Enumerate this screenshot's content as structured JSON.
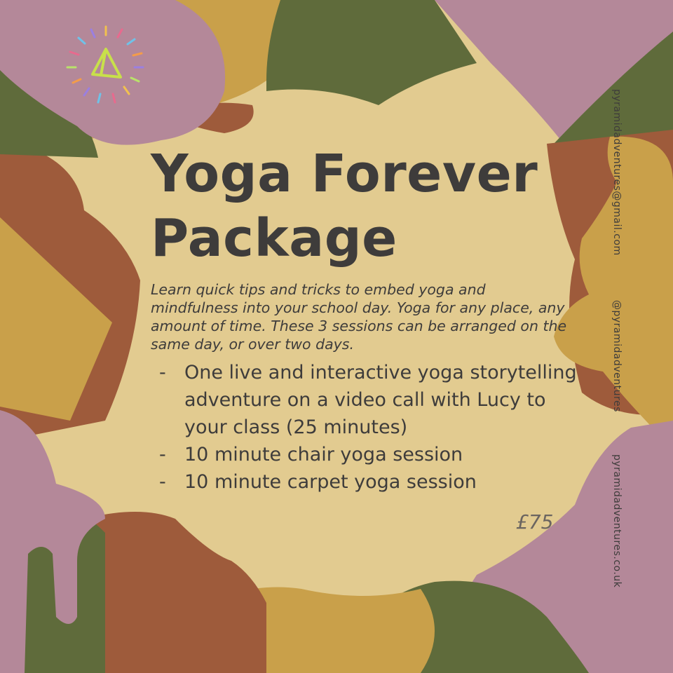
{
  "poster": {
    "title_line1": "Yoga Forever",
    "title_line2": "Package",
    "intro": "Learn quick tips and tricks to embed yoga and mindfulness into your school day.  Yoga for any place, any amount of time.  These 3 sessions can be arranged on the same day, or over two days.",
    "bullet_char": "-",
    "items": [
      {
        "text": "One live and interactive yoga storytelling adventure on a video call with Lucy to your class (25 minutes)"
      },
      {
        "text": "10 minute chair yoga session"
      },
      {
        "text": "10 minute carpet yoga session"
      }
    ],
    "price": "£75"
  },
  "contact": {
    "email": "pyramidadventures@gmail.com",
    "handle": "@pyramidadventures",
    "website": "pyramidadventures.co.uk"
  },
  "logo": {
    "icon": "pyramid-sunburst-icon",
    "ray_colors": [
      "#e86a8e",
      "#f2c14e",
      "#6fc2e8",
      "#9b7fe0",
      "#f39c4a",
      "#b9e26a"
    ],
    "pyramid_color": "#c8e04a"
  },
  "palette": {
    "background": "#e2cb90",
    "mauve": "#b48899",
    "olive": "#5f6b3b",
    "mustard": "#c9a04a",
    "rust": "#9e5b3b",
    "text": "#3e3c3b"
  }
}
